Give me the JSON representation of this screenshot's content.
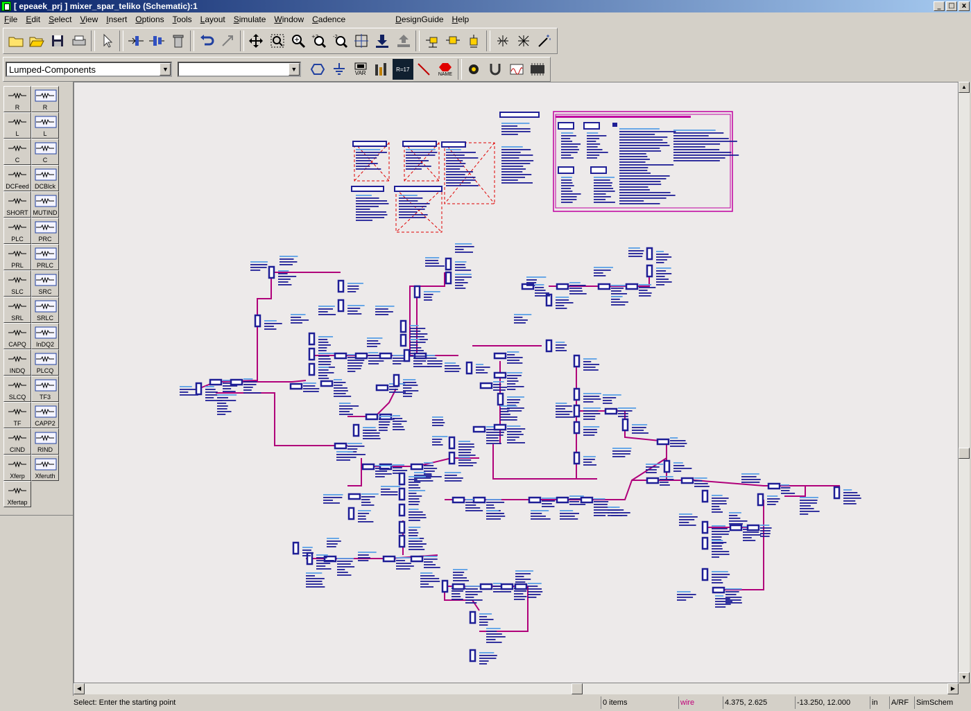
{
  "window": {
    "title": "[ epeaek_prj ] mixer_spar_teliko (Schematic):1",
    "buttons": [
      "_",
      "□",
      "x"
    ]
  },
  "menu": [
    "File",
    "Edit",
    "Select",
    "View",
    "Insert",
    "Options",
    "Tools",
    "Layout",
    "Simulate",
    "Window",
    "Cadence",
    "DesignGuide",
    "Help"
  ],
  "toolbar": {
    "palette_combo": "Lumped-Components",
    "second_combo": "",
    "var_label": "VAR",
    "name_label": "NAME",
    "r17_label": "R=17"
  },
  "palette": {
    "items": [
      "R",
      "R",
      "L",
      "L",
      "C",
      "C",
      "DCFeed",
      "DCBlck",
      "SHORT",
      "MUTIND",
      "PLC",
      "PRC",
      "PRL",
      "PRLC",
      "SLC",
      "SRC",
      "SRL",
      "SRLC",
      "CAPQ",
      "InDQ2",
      "INDQ",
      "PLCQ",
      "SLCQ",
      "TF3",
      "TF",
      "CAPP2",
      "CIND",
      "RIND",
      "Xferp",
      "Xferuth",
      "Xfertap"
    ]
  },
  "status": {
    "message": "Select: Enter the starting point",
    "items": "0 items",
    "mode": "wire",
    "coord1": "4.375, 2.625",
    "coord2": "-13.250, 12.000",
    "units": "in",
    "domain": "A/RF",
    "sim": "SimSchem"
  },
  "colors": {
    "wire": "#b0007a",
    "component": "#1e1e96",
    "label": "#5aa0e6",
    "canvas": "#edeaea"
  }
}
